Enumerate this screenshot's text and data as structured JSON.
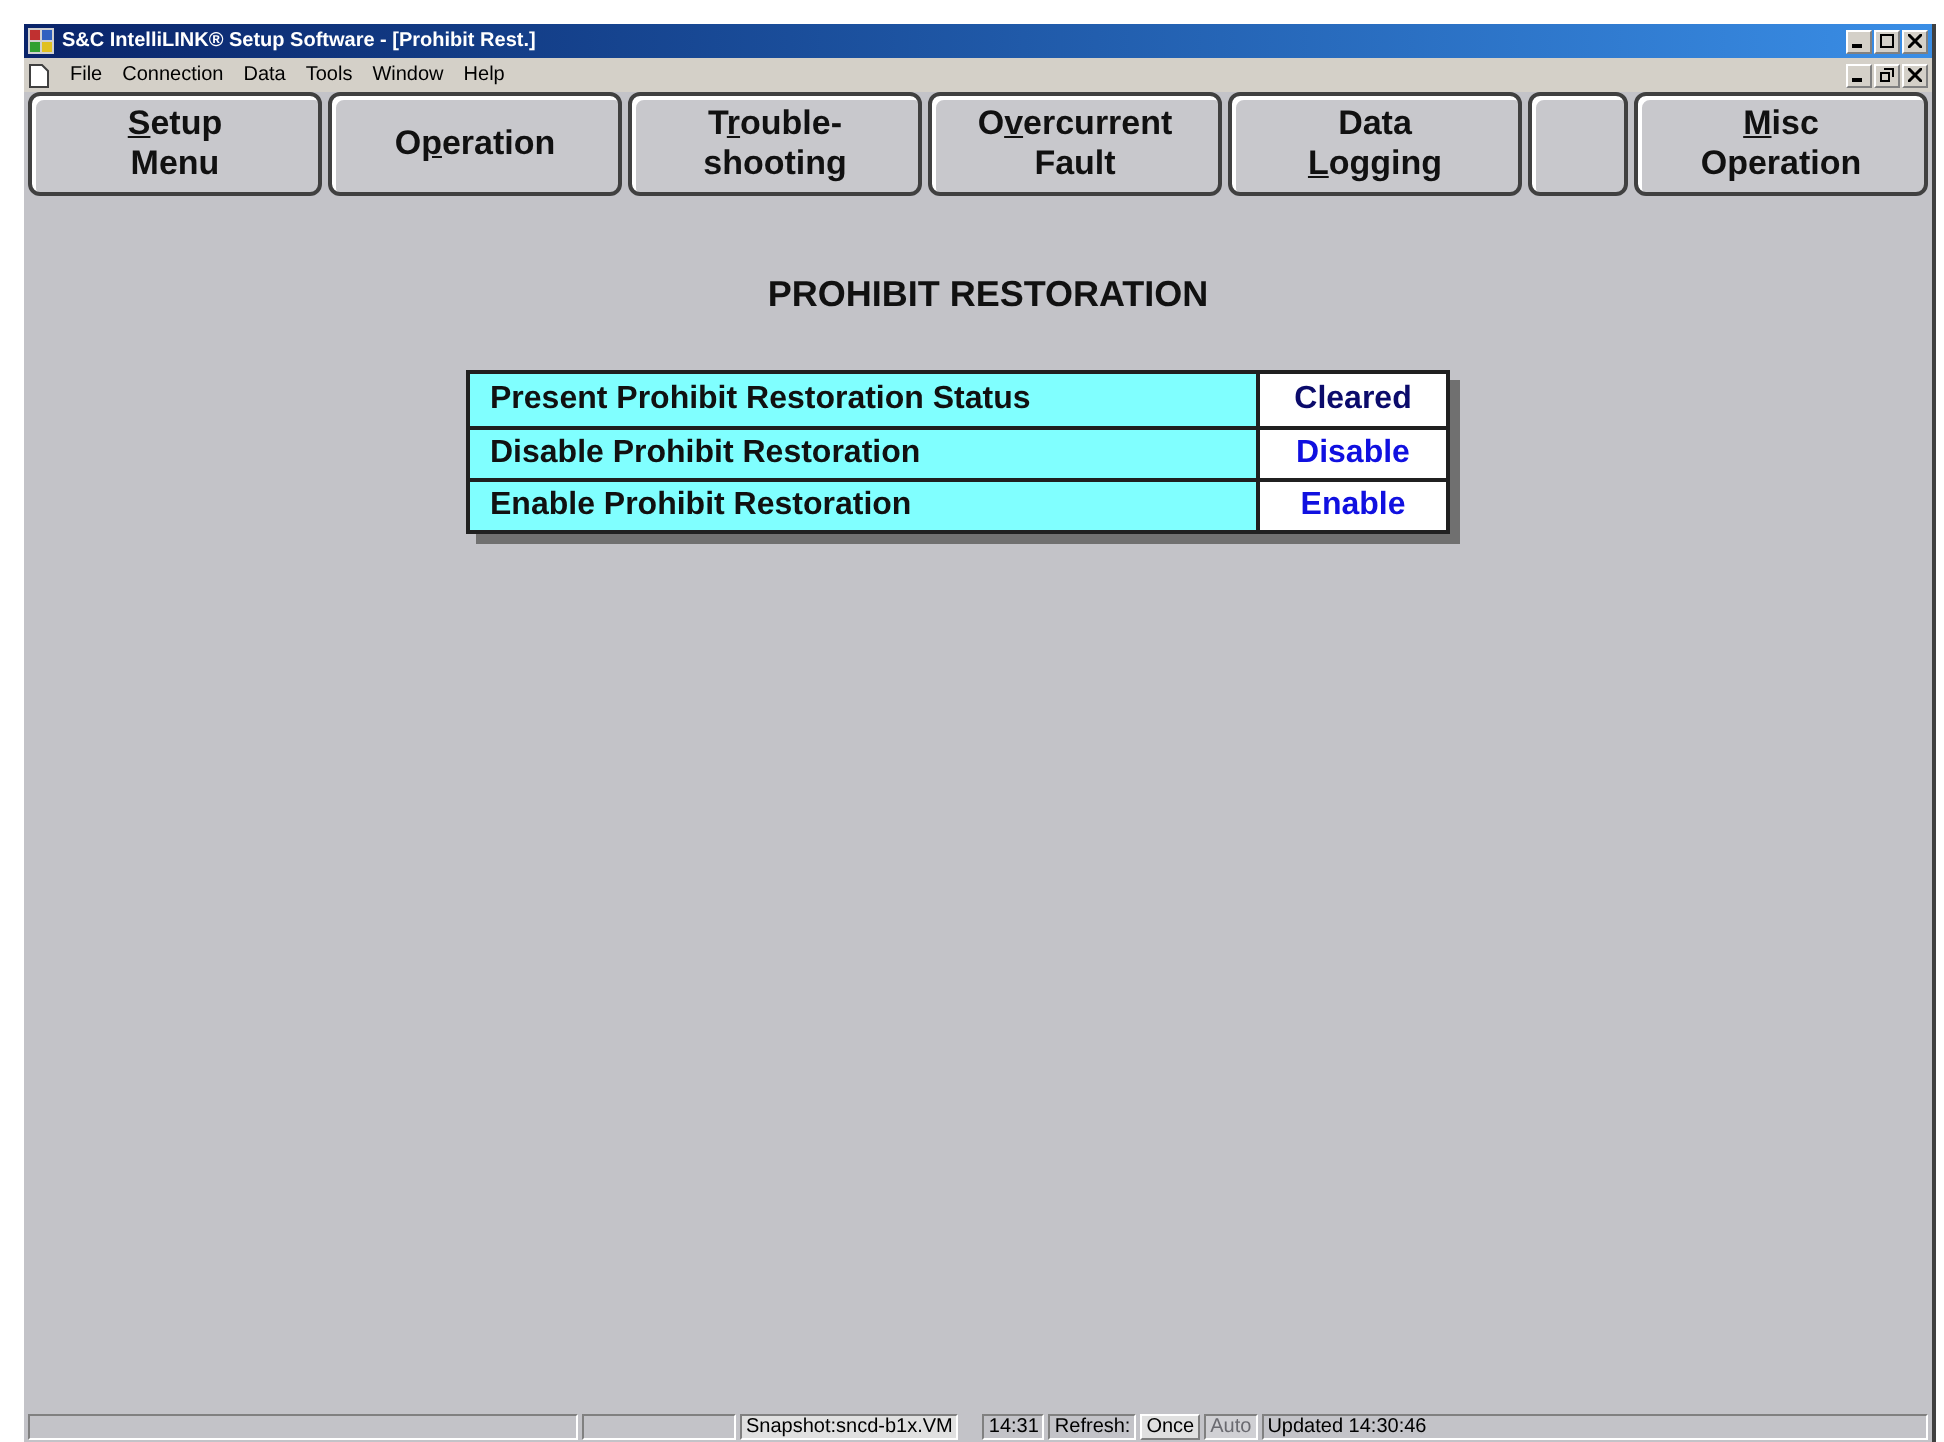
{
  "window": {
    "title": "S&C IntelliLINK® Setup Software - [Prohibit Rest.]"
  },
  "menu": [
    "File",
    "Connection",
    "Data",
    "Tools",
    "Window",
    "Help"
  ],
  "nav_buttons": [
    {
      "kind": "label",
      "lines": [
        {
          "key": "S",
          "post": "etup"
        },
        {
          "pre": "Menu"
        }
      ]
    },
    {
      "kind": "label",
      "lines": [
        {
          "pre": "O",
          "key": "p",
          "post": "eration"
        }
      ]
    },
    {
      "kind": "label",
      "lines": [
        {
          "pre": "T",
          "key": "r",
          "post": "ouble-"
        },
        {
          "pre": "shooting"
        }
      ]
    },
    {
      "kind": "label",
      "lines": [
        {
          "pre": "O",
          "key": "v",
          "post": "ercurrent"
        },
        {
          "pre": "Fault"
        }
      ]
    },
    {
      "kind": "label",
      "lines": [
        {
          "pre": "Data"
        },
        {
          "key": "L",
          "post": "ogging"
        }
      ]
    },
    {
      "kind": "blank"
    },
    {
      "kind": "label",
      "lines": [
        {
          "key": "M",
          "post": "isc"
        },
        {
          "pre": "Operation"
        }
      ]
    }
  ],
  "heading": "PROHIBIT RESTORATION",
  "rows": [
    {
      "label": "Present Prohibit Restoration Status",
      "value": "Cleared",
      "kind": "status"
    },
    {
      "label": "Disable Prohibit Restoration",
      "value": "Disable",
      "kind": "action"
    },
    {
      "label": "Enable Prohibit Restoration",
      "value": "Enable",
      "kind": "action"
    }
  ],
  "status_bar": {
    "snapshot": "Snapshot:sncd-b1x.VM",
    "time": "14:31",
    "refresh_label": "Refresh:",
    "refresh_options": [
      {
        "label": "Once",
        "disabled": false
      },
      {
        "label": "Auto",
        "disabled": true
      }
    ],
    "updated": "Updated 14:30:46"
  }
}
